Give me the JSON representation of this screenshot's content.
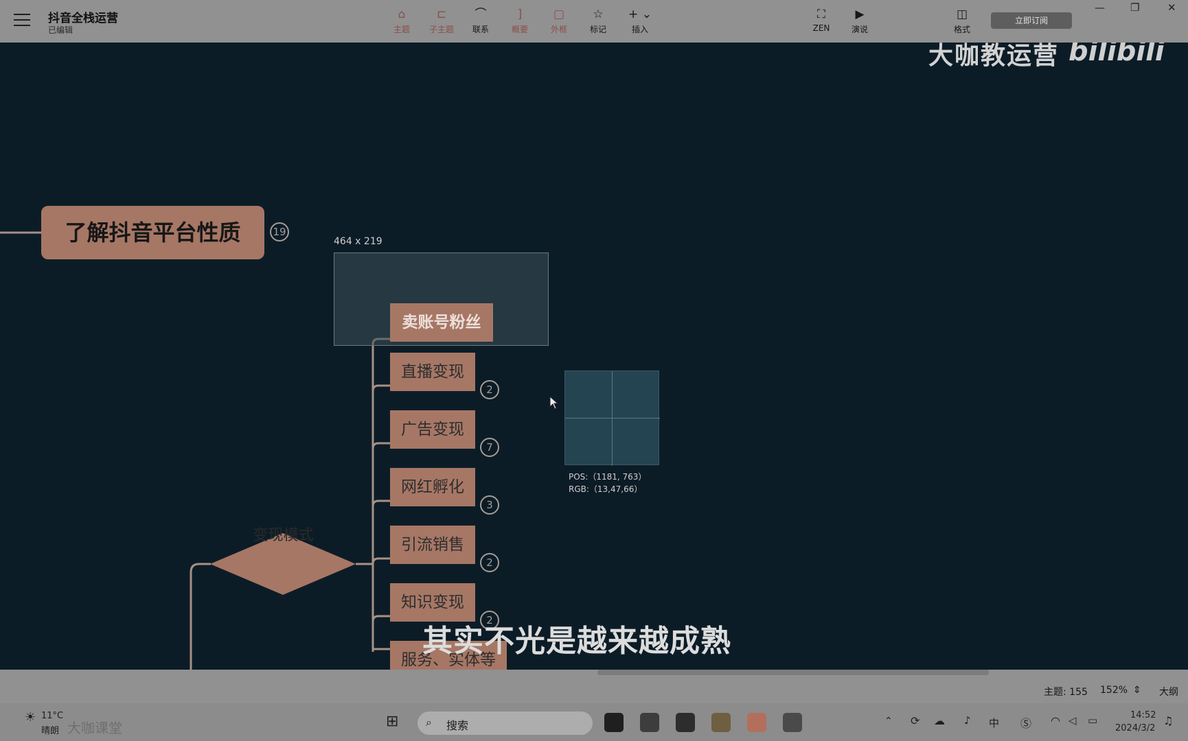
{
  "app": {
    "title": "抖音全栈运营",
    "status": "已编辑",
    "subscribe_label": "立即订阅"
  },
  "toolbar": {
    "tools": [
      {
        "label": "主题",
        "icon": "topic-icon",
        "glyph": "⌂"
      },
      {
        "label": "子主题",
        "icon": "subtopic-icon",
        "glyph": "⊏"
      },
      {
        "label": "联系",
        "icon": "relationship-icon",
        "glyph": "⌒"
      },
      {
        "label": "概要",
        "icon": "summary-icon",
        "glyph": "]"
      },
      {
        "label": "外框",
        "icon": "boundary-icon",
        "glyph": "▢"
      },
      {
        "label": "标记",
        "icon": "star-icon",
        "glyph": "☆"
      },
      {
        "label": "插入",
        "icon": "plus-icon",
        "glyph": "+ ⌄"
      },
      {
        "label": "ZEN",
        "icon": "zen-icon",
        "glyph": "⛶"
      },
      {
        "label": "演说",
        "icon": "play-icon",
        "glyph": "▶"
      },
      {
        "label": "格式",
        "icon": "panel-icon",
        "glyph": "◫"
      }
    ],
    "window_controls": {
      "minimize": "—",
      "restore": "❐",
      "close": "✕"
    }
  },
  "canvas": {
    "watermark": "大咖教运营",
    "bili_logo": "bilibili",
    "root_topic": {
      "label": "了解抖音平台性质",
      "count": "19"
    },
    "selection_size": "464 x 219",
    "branch": {
      "diamond_label": "变现模式",
      "nodes": [
        {
          "label": "卖账号粉丝",
          "count": "",
          "selected": true
        },
        {
          "label": "直播变现",
          "count": "2"
        },
        {
          "label": "广告变现",
          "count": "7"
        },
        {
          "label": "网红孵化",
          "count": "3"
        },
        {
          "label": "引流销售",
          "count": "2"
        },
        {
          "label": "知识变现",
          "count": "2"
        },
        {
          "label": "服务、实体等",
          "count": ""
        }
      ]
    },
    "picker": {
      "pos": "POS:（1181, 763）",
      "rgb": "RGB:（13,47,66）"
    },
    "subtitle": "其实不光是越来越成熟"
  },
  "statusbar": {
    "topic_count": "主题: 155",
    "zoom": "152%",
    "outline_label": "大纲"
  },
  "taskbar": {
    "weather_temp": "11°C",
    "weather_desc": "晴朗",
    "logo_text": "大咖课堂",
    "search_placeholder": "搜索",
    "ime_label": "中",
    "time": "14:52",
    "date": "2024/3/2"
  },
  "colors": {
    "canvas_bg": "#0c1c27",
    "node_fill": "#a67765",
    "toolbar_bg": "#919191",
    "connector": "#a89184"
  }
}
